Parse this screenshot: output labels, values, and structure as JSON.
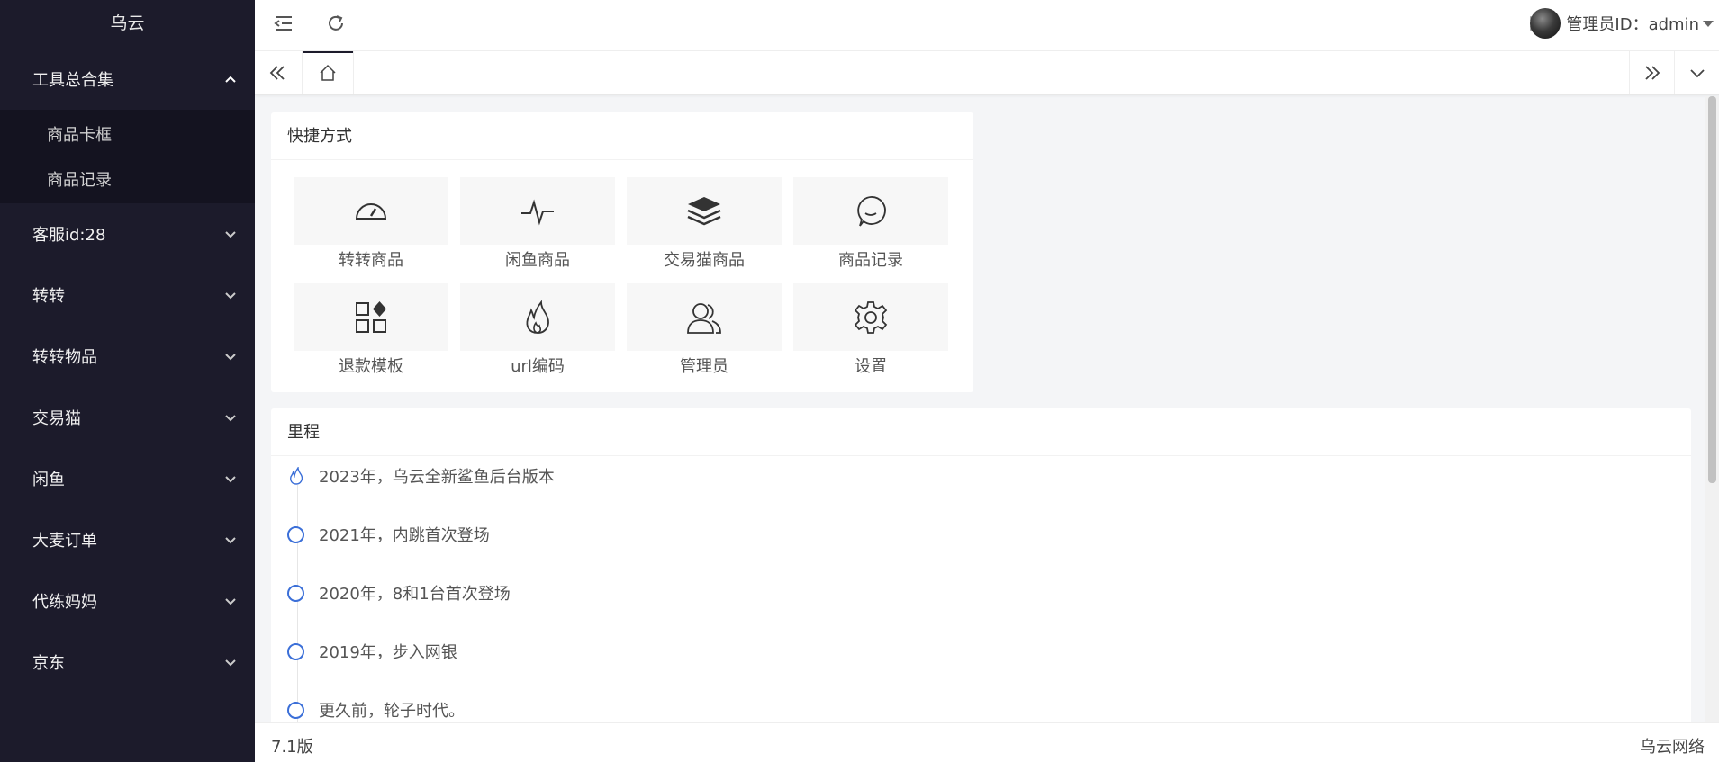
{
  "app": {
    "brand": "乌云"
  },
  "sidebar": {
    "items": [
      {
        "label": "工具总合集",
        "expanded": true,
        "children": [
          {
            "label": "商品卡框"
          },
          {
            "label": "商品记录"
          }
        ]
      },
      {
        "label": "客服id:28"
      },
      {
        "label": "转转"
      },
      {
        "label": "转转物品"
      },
      {
        "label": "交易猫"
      },
      {
        "label": "闲鱼"
      },
      {
        "label": "大麦订单"
      },
      {
        "label": "代练妈妈"
      },
      {
        "label": "京东"
      }
    ]
  },
  "header": {
    "user_label": "管理员ID：admin"
  },
  "quick": {
    "title": "快捷方式",
    "items": [
      {
        "label": "转转商品",
        "icon": "gauge-icon"
      },
      {
        "label": "闲鱼商品",
        "icon": "pulse-icon"
      },
      {
        "label": "交易猫商品",
        "icon": "layers-icon"
      },
      {
        "label": "商品记录",
        "icon": "chat-icon"
      },
      {
        "label": "退款模板",
        "icon": "apps-icon"
      },
      {
        "label": "url编码",
        "icon": "fire-icon"
      },
      {
        "label": "管理员",
        "icon": "users-icon"
      },
      {
        "label": "设置",
        "icon": "gear-icon"
      }
    ]
  },
  "timeline": {
    "title": "里程",
    "items": [
      {
        "text": "2023年，乌云全新鲨鱼后台版本"
      },
      {
        "text": "2021年，内跳首次登场"
      },
      {
        "text": "2020年，8和1台首次登场"
      },
      {
        "text": "2019年，步入网银"
      },
      {
        "text": "更久前，轮子时代。"
      }
    ]
  },
  "footer": {
    "version": "7.1版",
    "company": "乌云网络"
  },
  "colors": {
    "sidebar_bg": "#1c1b2b",
    "accent": "#3b6fd8"
  }
}
